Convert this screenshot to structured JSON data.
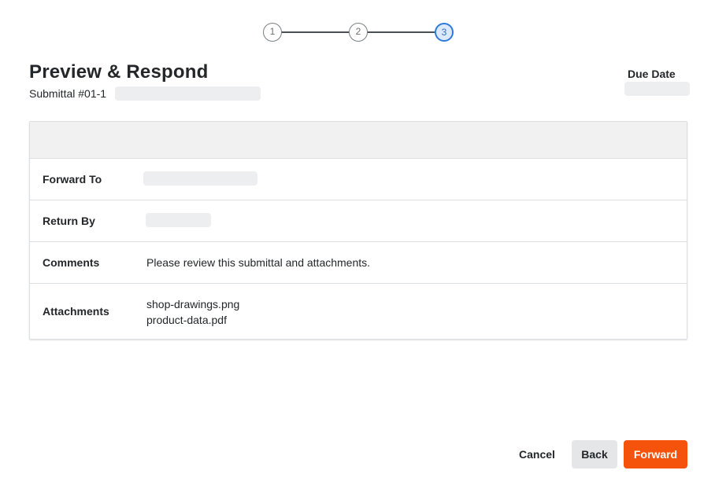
{
  "stepper": {
    "steps": [
      "1",
      "2",
      "3"
    ],
    "current_step": 3,
    "accent_color": "#2d7ad8"
  },
  "header": {
    "title": "Preview & Respond",
    "subtitle": "Submittal #01-1",
    "due_date_label": "Due Date"
  },
  "details": {
    "rows": [
      {
        "label": "Forward To"
      },
      {
        "label": "Return By"
      },
      {
        "label": "Comments",
        "value": "Please review this submittal and attachments."
      },
      {
        "label": "Attachments",
        "files": [
          "shop-drawings.png",
          "product-data.pdf"
        ]
      }
    ]
  },
  "footer": {
    "cancel_label": "Cancel",
    "back_label": "Back",
    "forward_label": "Forward",
    "primary_color": "#f5520c"
  }
}
